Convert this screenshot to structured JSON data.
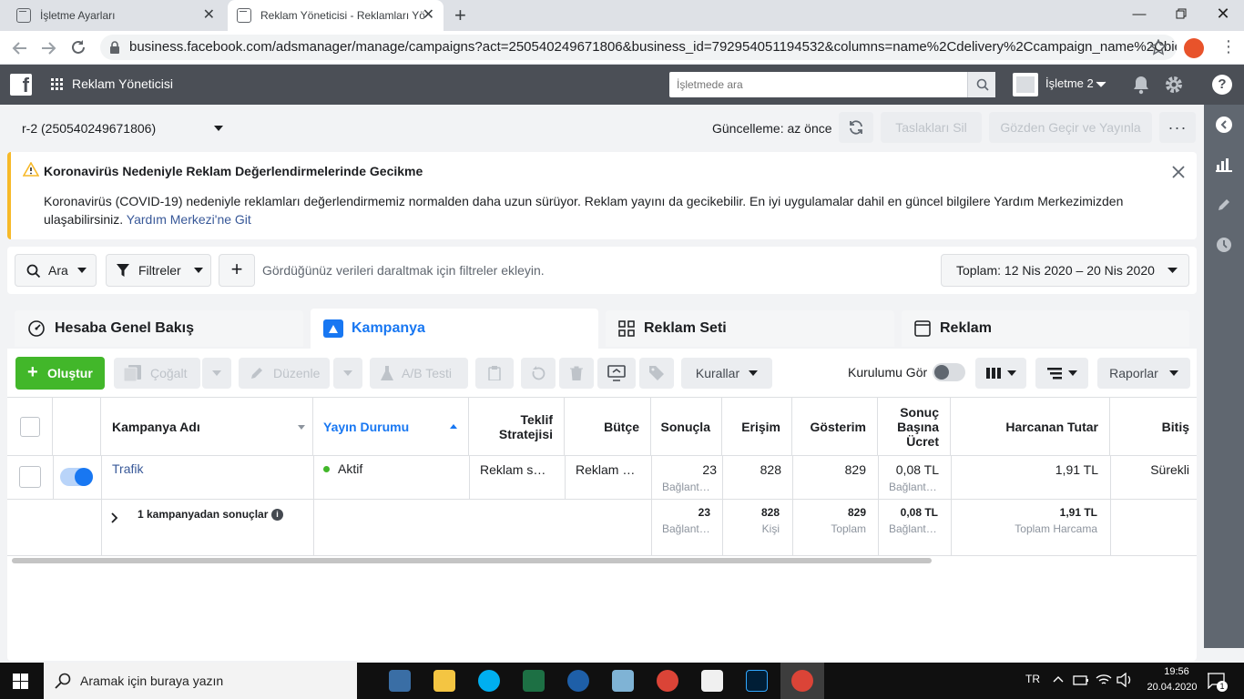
{
  "browser": {
    "tabs": [
      {
        "title": "İşletme Ayarları"
      },
      {
        "title": "Reklam Yöneticisi - Reklamları Yö"
      }
    ],
    "url": "business.facebook.com/adsmanager/manage/campaigns?act=250540249671806&business_id=792954051194532&columns=name%2Cdelivery%2Ccampaign_name%2Cbid%2Cb..."
  },
  "fb_header": {
    "app_name": "Reklam Yöneticisi",
    "search_placeholder": "İşletmede ara",
    "business_name": "İşletme 2"
  },
  "toolbar": {
    "account": "r-2 (250540249671806)",
    "update_status": "Güncelleme: az önce",
    "discard_drafts": "Taslakları Sil",
    "review_publish": "Gözden Geçir ve Yayınla"
  },
  "banner": {
    "title": "Koronavirüs Nedeniyle Reklam Değerlendirmelerinde Gecikme",
    "body": "Koronavirüs (COVID-19) nedeniyle reklamları değerlendirmemiz normalden daha uzun sürüyor. Reklam yayını da gecikebilir. En iyi uygulamalar dahil en güncel bilgilere Yardım Merkezimizden ulaşabilirsiniz.",
    "link": "Yardım Merkezi'ne Git"
  },
  "filterbar": {
    "search": "Ara",
    "filters": "Filtreler",
    "placeholder": "Gördüğünüz verileri daraltmak için filtreler ekleyin.",
    "date_range": "Toplam: 12 Nis 2020 – 20 Nis 2020"
  },
  "level_tabs": [
    "Hesaba Genel Bakış",
    "Kampanya",
    "Reklam Seti",
    "Reklam"
  ],
  "actions": {
    "create": "Oluştur",
    "duplicate": "Çoğalt",
    "edit": "Düzenle",
    "ab_test": "A/B Testi",
    "rules": "Kurallar",
    "see_setup": "Kurulumu Gör",
    "reports": "Raporlar"
  },
  "table": {
    "headers": {
      "name": "Kampanya Adı",
      "delivery": "Yayın Durumu",
      "bid_line1": "Teklif",
      "bid_line2": "Stratejisi",
      "budget": "Bütçe",
      "results": "Sonuçla",
      "reach": "Erişim",
      "impressions": "Gösterim",
      "cpr_line1": "Sonuç",
      "cpr_line2": "Başına",
      "cpr_line3": "Ücret",
      "spent": "Harcanan Tutar",
      "end": "Bitiş"
    },
    "row": {
      "name": "Trafik",
      "delivery": "Aktif",
      "bid": "Reklam s…",
      "budget": "Reklam …",
      "results": "23",
      "results_sub": "Bağlant…",
      "reach": "828",
      "impressions": "829",
      "cpr": "0,08 TL",
      "cpr_sub": "Bağlant…",
      "spent": "1,91 TL",
      "end": "Sürekli",
      "toggle_on": true
    },
    "summary": {
      "label": "1 kampanyadan sonuçlar",
      "results": "23",
      "results_sub": "Bağlant…",
      "reach": "828",
      "reach_sub": "Kişi",
      "impressions": "829",
      "impressions_sub": "Toplam",
      "cpr": "0,08 TL",
      "cpr_sub": "Bağlant…",
      "spent": "1,91 TL",
      "spent_sub": "Toplam Harcama"
    }
  },
  "taskbar": {
    "search_placeholder": "Aramak için buraya yazın",
    "lang": "TR",
    "time": "19:56",
    "date": "20.04.2020",
    "notifications": "1"
  },
  "colors": {
    "fb_bar": "#4b4f56",
    "accent_blue": "#1877f2",
    "create_green": "#42b72a",
    "warning_yellow": "#f7b928",
    "active_dot": "#42b72a"
  }
}
